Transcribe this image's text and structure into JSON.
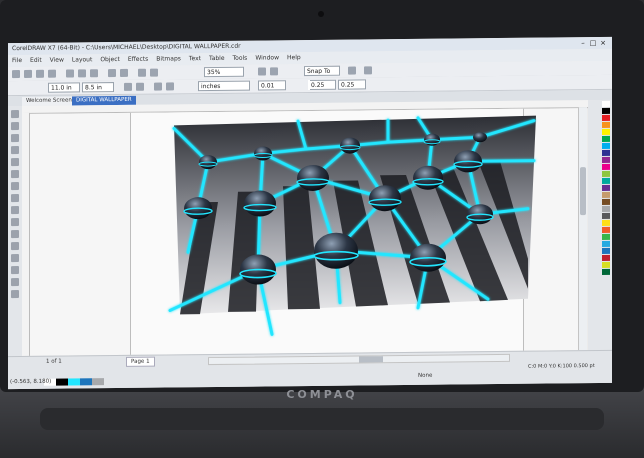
{
  "device": {
    "brand": "COMPAQ"
  },
  "window": {
    "title": "CorelDRAW X7 (64-Bit) - C:\\Users\\MICHAEL\\Desktop\\DIGITAL WALLPAPER.cdr",
    "controls": [
      "–",
      "□",
      "×"
    ]
  },
  "menu": [
    "File",
    "Edit",
    "View",
    "Layout",
    "Object",
    "Effects",
    "Bitmaps",
    "Text",
    "Table",
    "Tools",
    "Window",
    "Help"
  ],
  "toolbar": {
    "zoom": "35%",
    "snap_to": "Snap To",
    "width": "11.0 in",
    "height": "8.5 in",
    "units": "inches",
    "nudge": "0.01",
    "dup_x": "0.25",
    "dup_y": "0.25"
  },
  "tabs": [
    {
      "label": "Welcome Screen",
      "active": false
    },
    {
      "label": "DIGITAL WALLPAPER",
      "active": true
    }
  ],
  "status": {
    "page_nav": "1 of 1",
    "page_tab": "Page 1",
    "coords": "(-0.563, 8.180)",
    "hint": "None",
    "fill_info": "C:0 M:0 Y:0 K:100 0.500 pt"
  },
  "colors": {
    "glow": "#22e6ff",
    "accent_tab": "#3b6fc3",
    "palette": [
      "#ffffff",
      "#000000",
      "#e31e24",
      "#f7931e",
      "#fff200",
      "#00a651",
      "#00aeef",
      "#2e3192",
      "#92278f",
      "#ec008c",
      "#8dc63f",
      "#00a99d",
      "#662d91",
      "#c69c6d",
      "#754c24",
      "#a7a9ac",
      "#58595b",
      "#ffde17",
      "#f15a29",
      "#39b54a",
      "#27aae1",
      "#1c75bc",
      "#be1e2d",
      "#d7df23",
      "#006838"
    ]
  },
  "icons": [
    "pick-tool-icon",
    "shape-tool-icon",
    "crop-tool-icon",
    "zoom-tool-icon",
    "freehand-tool-icon",
    "rectangle-tool-icon",
    "ellipse-tool-icon",
    "polygon-tool-icon",
    "text-tool-icon",
    "fill-tool-icon"
  ]
}
